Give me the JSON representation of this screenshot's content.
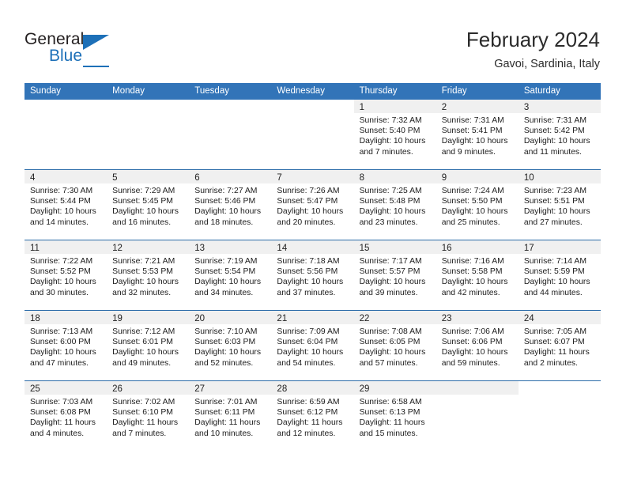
{
  "brand": {
    "name_top": "General",
    "name_bottom": "Blue",
    "accent_color": "#1d70b8"
  },
  "header": {
    "title": "February 2024",
    "subtitle": "Gavoi, Sardinia, Italy"
  },
  "theme": {
    "header_bg": "#3274b8",
    "row_divider": "#2d6da9",
    "day_band_bg": "#f0f0f0"
  },
  "weekdays": [
    "Sunday",
    "Monday",
    "Tuesday",
    "Wednesday",
    "Thursday",
    "Friday",
    "Saturday"
  ],
  "labels": {
    "sunrise_prefix": "Sunrise:",
    "sunset_prefix": "Sunset:",
    "daylight_prefix": "Daylight:"
  },
  "weeks": [
    [
      {
        "blank": true
      },
      {
        "blank": true
      },
      {
        "blank": true
      },
      {
        "blank": true
      },
      {
        "day": "1",
        "sunrise": "Sunrise: 7:32 AM",
        "sunset": "Sunset: 5:40 PM",
        "daylight_line1": "Daylight: 10 hours",
        "daylight_line2": "and 7 minutes."
      },
      {
        "day": "2",
        "sunrise": "Sunrise: 7:31 AM",
        "sunset": "Sunset: 5:41 PM",
        "daylight_line1": "Daylight: 10 hours",
        "daylight_line2": "and 9 minutes."
      },
      {
        "day": "3",
        "sunrise": "Sunrise: 7:31 AM",
        "sunset": "Sunset: 5:42 PM",
        "daylight_line1": "Daylight: 10 hours",
        "daylight_line2": "and 11 minutes."
      }
    ],
    [
      {
        "day": "4",
        "sunrise": "Sunrise: 7:30 AM",
        "sunset": "Sunset: 5:44 PM",
        "daylight_line1": "Daylight: 10 hours",
        "daylight_line2": "and 14 minutes."
      },
      {
        "day": "5",
        "sunrise": "Sunrise: 7:29 AM",
        "sunset": "Sunset: 5:45 PM",
        "daylight_line1": "Daylight: 10 hours",
        "daylight_line2": "and 16 minutes."
      },
      {
        "day": "6",
        "sunrise": "Sunrise: 7:27 AM",
        "sunset": "Sunset: 5:46 PM",
        "daylight_line1": "Daylight: 10 hours",
        "daylight_line2": "and 18 minutes."
      },
      {
        "day": "7",
        "sunrise": "Sunrise: 7:26 AM",
        "sunset": "Sunset: 5:47 PM",
        "daylight_line1": "Daylight: 10 hours",
        "daylight_line2": "and 20 minutes."
      },
      {
        "day": "8",
        "sunrise": "Sunrise: 7:25 AM",
        "sunset": "Sunset: 5:48 PM",
        "daylight_line1": "Daylight: 10 hours",
        "daylight_line2": "and 23 minutes."
      },
      {
        "day": "9",
        "sunrise": "Sunrise: 7:24 AM",
        "sunset": "Sunset: 5:50 PM",
        "daylight_line1": "Daylight: 10 hours",
        "daylight_line2": "and 25 minutes."
      },
      {
        "day": "10",
        "sunrise": "Sunrise: 7:23 AM",
        "sunset": "Sunset: 5:51 PM",
        "daylight_line1": "Daylight: 10 hours",
        "daylight_line2": "and 27 minutes."
      }
    ],
    [
      {
        "day": "11",
        "sunrise": "Sunrise: 7:22 AM",
        "sunset": "Sunset: 5:52 PM",
        "daylight_line1": "Daylight: 10 hours",
        "daylight_line2": "and 30 minutes."
      },
      {
        "day": "12",
        "sunrise": "Sunrise: 7:21 AM",
        "sunset": "Sunset: 5:53 PM",
        "daylight_line1": "Daylight: 10 hours",
        "daylight_line2": "and 32 minutes."
      },
      {
        "day": "13",
        "sunrise": "Sunrise: 7:19 AM",
        "sunset": "Sunset: 5:54 PM",
        "daylight_line1": "Daylight: 10 hours",
        "daylight_line2": "and 34 minutes."
      },
      {
        "day": "14",
        "sunrise": "Sunrise: 7:18 AM",
        "sunset": "Sunset: 5:56 PM",
        "daylight_line1": "Daylight: 10 hours",
        "daylight_line2": "and 37 minutes."
      },
      {
        "day": "15",
        "sunrise": "Sunrise: 7:17 AM",
        "sunset": "Sunset: 5:57 PM",
        "daylight_line1": "Daylight: 10 hours",
        "daylight_line2": "and 39 minutes."
      },
      {
        "day": "16",
        "sunrise": "Sunrise: 7:16 AM",
        "sunset": "Sunset: 5:58 PM",
        "daylight_line1": "Daylight: 10 hours",
        "daylight_line2": "and 42 minutes."
      },
      {
        "day": "17",
        "sunrise": "Sunrise: 7:14 AM",
        "sunset": "Sunset: 5:59 PM",
        "daylight_line1": "Daylight: 10 hours",
        "daylight_line2": "and 44 minutes."
      }
    ],
    [
      {
        "day": "18",
        "sunrise": "Sunrise: 7:13 AM",
        "sunset": "Sunset: 6:00 PM",
        "daylight_line1": "Daylight: 10 hours",
        "daylight_line2": "and 47 minutes."
      },
      {
        "day": "19",
        "sunrise": "Sunrise: 7:12 AM",
        "sunset": "Sunset: 6:01 PM",
        "daylight_line1": "Daylight: 10 hours",
        "daylight_line2": "and 49 minutes."
      },
      {
        "day": "20",
        "sunrise": "Sunrise: 7:10 AM",
        "sunset": "Sunset: 6:03 PM",
        "daylight_line1": "Daylight: 10 hours",
        "daylight_line2": "and 52 minutes."
      },
      {
        "day": "21",
        "sunrise": "Sunrise: 7:09 AM",
        "sunset": "Sunset: 6:04 PM",
        "daylight_line1": "Daylight: 10 hours",
        "daylight_line2": "and 54 minutes."
      },
      {
        "day": "22",
        "sunrise": "Sunrise: 7:08 AM",
        "sunset": "Sunset: 6:05 PM",
        "daylight_line1": "Daylight: 10 hours",
        "daylight_line2": "and 57 minutes."
      },
      {
        "day": "23",
        "sunrise": "Sunrise: 7:06 AM",
        "sunset": "Sunset: 6:06 PM",
        "daylight_line1": "Daylight: 10 hours",
        "daylight_line2": "and 59 minutes."
      },
      {
        "day": "24",
        "sunrise": "Sunrise: 7:05 AM",
        "sunset": "Sunset: 6:07 PM",
        "daylight_line1": "Daylight: 11 hours",
        "daylight_line2": "and 2 minutes."
      }
    ],
    [
      {
        "day": "25",
        "sunrise": "Sunrise: 7:03 AM",
        "sunset": "Sunset: 6:08 PM",
        "daylight_line1": "Daylight: 11 hours",
        "daylight_line2": "and 4 minutes."
      },
      {
        "day": "26",
        "sunrise": "Sunrise: 7:02 AM",
        "sunset": "Sunset: 6:10 PM",
        "daylight_line1": "Daylight: 11 hours",
        "daylight_line2": "and 7 minutes."
      },
      {
        "day": "27",
        "sunrise": "Sunrise: 7:01 AM",
        "sunset": "Sunset: 6:11 PM",
        "daylight_line1": "Daylight: 11 hours",
        "daylight_line2": "and 10 minutes."
      },
      {
        "day": "28",
        "sunrise": "Sunrise: 6:59 AM",
        "sunset": "Sunset: 6:12 PM",
        "daylight_line1": "Daylight: 11 hours",
        "daylight_line2": "and 12 minutes."
      },
      {
        "day": "29",
        "sunrise": "Sunrise: 6:58 AM",
        "sunset": "Sunset: 6:13 PM",
        "daylight_line1": "Daylight: 11 hours",
        "daylight_line2": "and 15 minutes."
      },
      {
        "blank": false,
        "empty": true
      },
      {
        "blank": true
      }
    ]
  ]
}
